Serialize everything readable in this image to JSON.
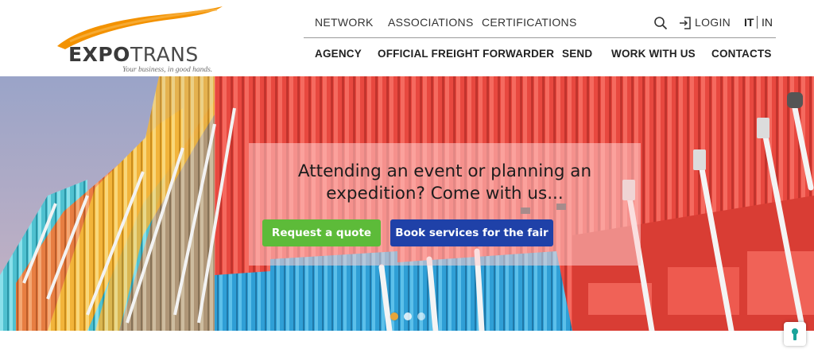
{
  "brand": {
    "logo_text_a": "EXPO",
    "logo_text_b": "TRANS",
    "tagline": "Your business, in good hands.",
    "accent_color": "#F39200"
  },
  "nav_top": {
    "links": [
      "NETWORK",
      "ASSOCIATIONS",
      "CERTIFICATIONS"
    ],
    "login_label": "LOGIN",
    "lang_active": "IT",
    "lang_other": "IN"
  },
  "nav_main": {
    "links": [
      "AGENCY",
      "OFFICIAL FREIGHT FORWARDER",
      "SEND",
      "WORK WITH US",
      "CONTACTS"
    ]
  },
  "hero": {
    "headline_line1": "Attending an event or planning an",
    "headline_line2": "expedition? Come with us...",
    "quote_button": "Request a quote",
    "fair_button": "Book services for the fair",
    "quote_color": "#5DBB39",
    "fair_color": "#1F41A8",
    "slide_count": 3,
    "active_slide": 1
  },
  "icons": {
    "search": "search-icon",
    "login": "login-icon",
    "lock": "lock-icon"
  }
}
